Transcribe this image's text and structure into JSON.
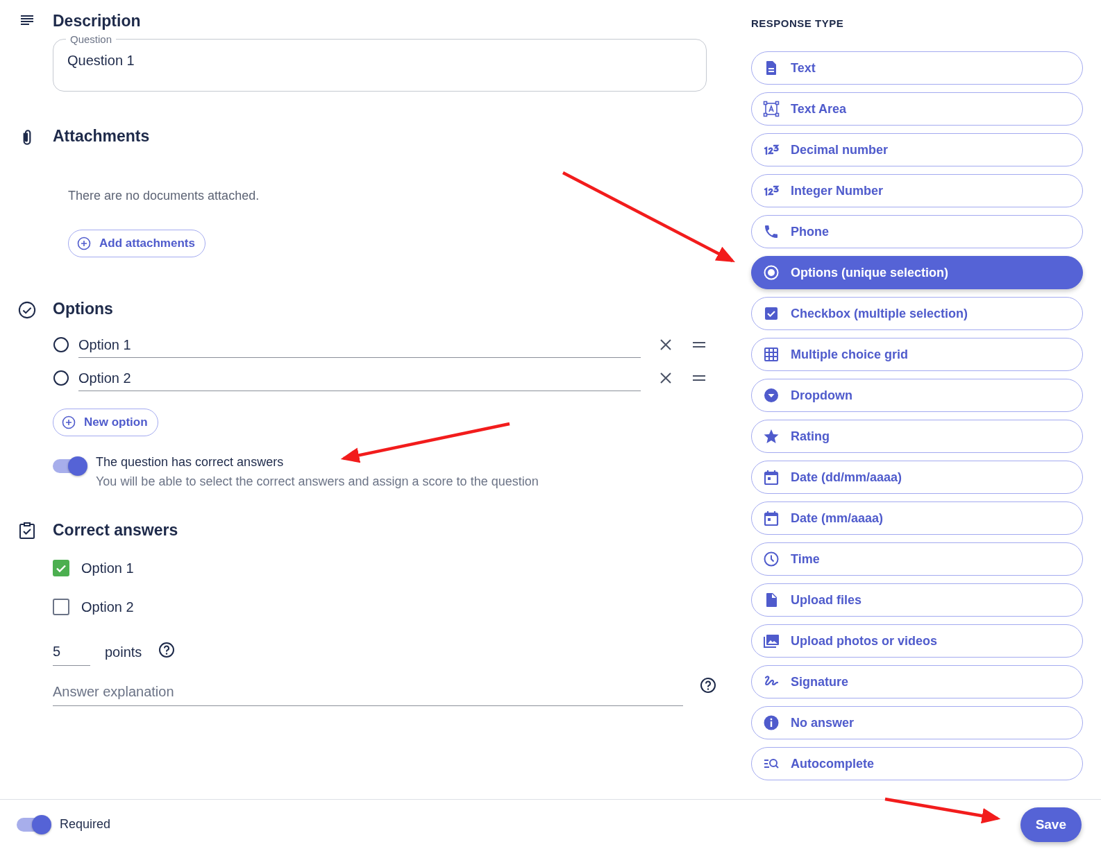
{
  "description": {
    "heading": "Description",
    "question_field": {
      "label": "Question",
      "value": "Question 1"
    }
  },
  "attachments": {
    "heading": "Attachments",
    "empty_message": "There are no documents attached.",
    "add_button": "Add attachments"
  },
  "options": {
    "heading": "Options",
    "items": [
      {
        "value": "Option 1"
      },
      {
        "value": "Option 2"
      }
    ],
    "new_option_button": "New option",
    "correct_answers_toggle": {
      "on": true,
      "label": "The question has correct answers",
      "hint": "You will be able to select the correct answers and assign a score to the question"
    }
  },
  "correct_answers": {
    "heading": "Correct answers",
    "items": [
      {
        "label": "Option 1",
        "checked": true
      },
      {
        "label": "Option 2",
        "checked": false
      }
    ],
    "points": {
      "value": "5",
      "label": "points"
    },
    "explanation": {
      "placeholder": "Answer explanation"
    }
  },
  "response_type": {
    "heading": "RESPONSE TYPE",
    "items": [
      {
        "label": "Text",
        "kind": "document",
        "selected": false
      },
      {
        "label": "Text Area",
        "kind": "textarea",
        "selected": false
      },
      {
        "label": "Decimal number",
        "kind": "number",
        "selected": false
      },
      {
        "label": "Integer Number",
        "kind": "number",
        "selected": false
      },
      {
        "label": "Phone",
        "kind": "phone",
        "selected": false
      },
      {
        "label": "Options (unique selection)",
        "kind": "radio",
        "selected": true
      },
      {
        "label": "Checkbox (multiple selection)",
        "kind": "checkbox",
        "selected": false
      },
      {
        "label": "Multiple choice grid",
        "kind": "grid",
        "selected": false
      },
      {
        "label": "Dropdown",
        "kind": "dropdown",
        "selected": false
      },
      {
        "label": "Rating",
        "kind": "star",
        "selected": false
      },
      {
        "label": "Date (dd/mm/aaaa)",
        "kind": "calendar",
        "selected": false
      },
      {
        "label": "Date (mm/aaaa)",
        "kind": "calendar",
        "selected": false
      },
      {
        "label": "Time",
        "kind": "clock",
        "selected": false
      },
      {
        "label": "Upload files",
        "kind": "file",
        "selected": false
      },
      {
        "label": "Upload photos or videos",
        "kind": "photos",
        "selected": false
      },
      {
        "label": "Signature",
        "kind": "signature",
        "selected": false
      },
      {
        "label": "No answer",
        "kind": "info",
        "selected": false
      },
      {
        "label": "Autocomplete",
        "kind": "autocomplete",
        "selected": false
      }
    ]
  },
  "footer": {
    "required": {
      "on": true,
      "label": "Required"
    },
    "save_button": "Save"
  }
}
